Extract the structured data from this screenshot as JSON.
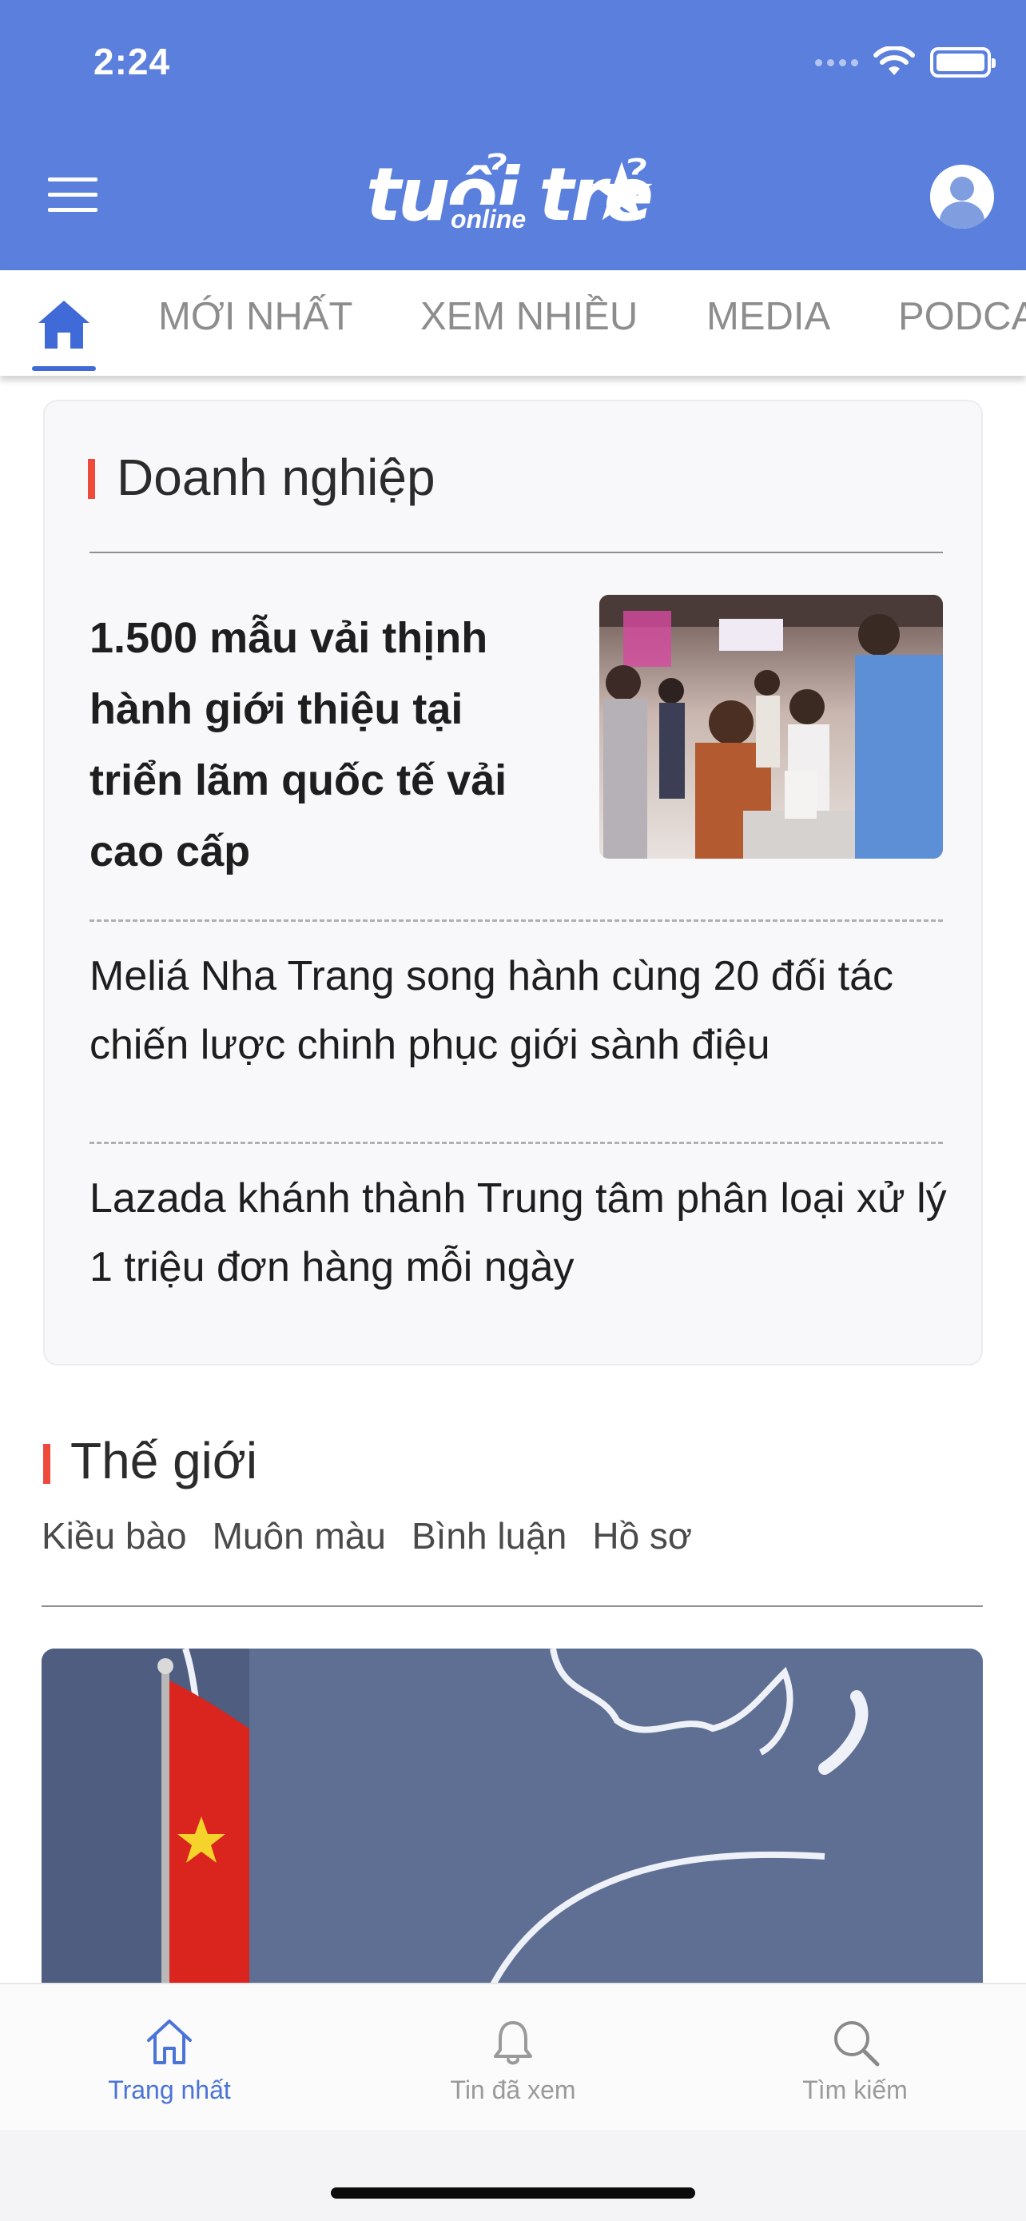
{
  "status_bar": {
    "time": "2:24"
  },
  "header": {
    "logo_main": "tuổi trẻ",
    "logo_sub": "online",
    "accent_color": "#5b7fdd"
  },
  "tabs": [
    {
      "label": "MỚI NHẤT"
    },
    {
      "label": "XEM NHIỀU"
    },
    {
      "label": "MEDIA"
    },
    {
      "label": "PODCA"
    }
  ],
  "business_section": {
    "title": "Doanh nghiệp",
    "lead_story": {
      "title": "1.500 mẫu vải thịnh hành giới thiệu tại triển lãm quốc tế vải cao cấp"
    },
    "stories": [
      {
        "title": "Meliá Nha Trang song hành cùng 20 đối tác chiến lược chinh phục giới sành điệu"
      },
      {
        "title": "Lazada khánh thành Trung tâm phân loại xử lý 1 triệu đơn hàng mỗi ngày"
      }
    ]
  },
  "world_section": {
    "title": "Thế giới",
    "subcategories": [
      "Kiều bào",
      "Muôn màu",
      "Bình luận",
      "Hồ sơ"
    ]
  },
  "bottom_nav": {
    "items": [
      {
        "label": "Trang nhất",
        "icon": "home-icon",
        "active": true
      },
      {
        "label": "Tin đã xem",
        "icon": "bell-icon",
        "active": false
      },
      {
        "label": "Tìm kiếm",
        "icon": "search-icon",
        "active": false
      }
    ]
  },
  "colors": {
    "active": "#4a74d8",
    "inactive": "#9a9a9a",
    "section_marker": "#ee4a3c"
  }
}
